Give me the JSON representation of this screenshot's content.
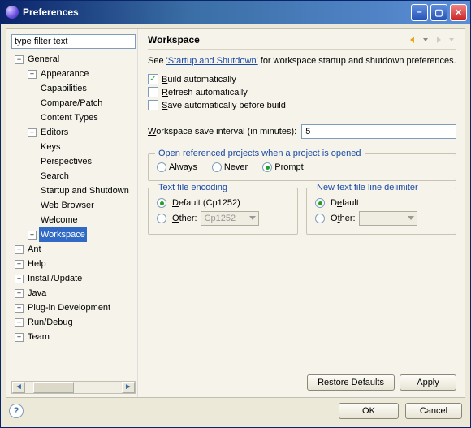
{
  "window": {
    "title": "Preferences"
  },
  "filter": {
    "placeholder": "type filter text"
  },
  "tree": {
    "general": "General",
    "appearance": "Appearance",
    "capabilities": "Capabilities",
    "compare": "Compare/Patch",
    "ctypes": "Content Types",
    "editors": "Editors",
    "keys": "Keys",
    "perspectives": "Perspectives",
    "search": "Search",
    "startup": "Startup and Shutdown",
    "webbrowser": "Web Browser",
    "welcome": "Welcome",
    "workspace": "Workspace",
    "ant": "Ant",
    "help": "Help",
    "install": "Install/Update",
    "java": "Java",
    "plugin": "Plug-in Development",
    "rundebug": "Run/Debug",
    "team": "Team"
  },
  "page": {
    "title": "Workspace",
    "descr_pre": "See ",
    "descr_link": "'Startup and Shutdown'",
    "descr_post": " for workspace startup and shutdown preferences.",
    "build_auto": "Build automatically",
    "refresh_auto": "Refresh automatically",
    "save_auto": "Save automatically before build",
    "interval_label": "Workspace save interval (in minutes):",
    "interval_value": "5",
    "open_ref_title": "Open referenced projects when a project is opened",
    "always": "Always",
    "never": "Never",
    "prompt": "Prompt",
    "encoding_title": "Text file encoding",
    "enc_default": "Default (Cp1252)",
    "enc_other": "Other:",
    "enc_other_value": "Cp1252",
    "delim_title": "New text file line delimiter",
    "delim_default": "Default",
    "delim_other": "Other:",
    "restore": "Restore Defaults",
    "apply": "Apply"
  },
  "footer": {
    "ok": "OK",
    "cancel": "Cancel"
  },
  "hotkeys": {
    "b": "B",
    "r": "R",
    "s": "S",
    "w": "W",
    "a": "A",
    "n": "N",
    "p": "P",
    "d": "D",
    "o": "O",
    "e": "e",
    "t": "t"
  }
}
